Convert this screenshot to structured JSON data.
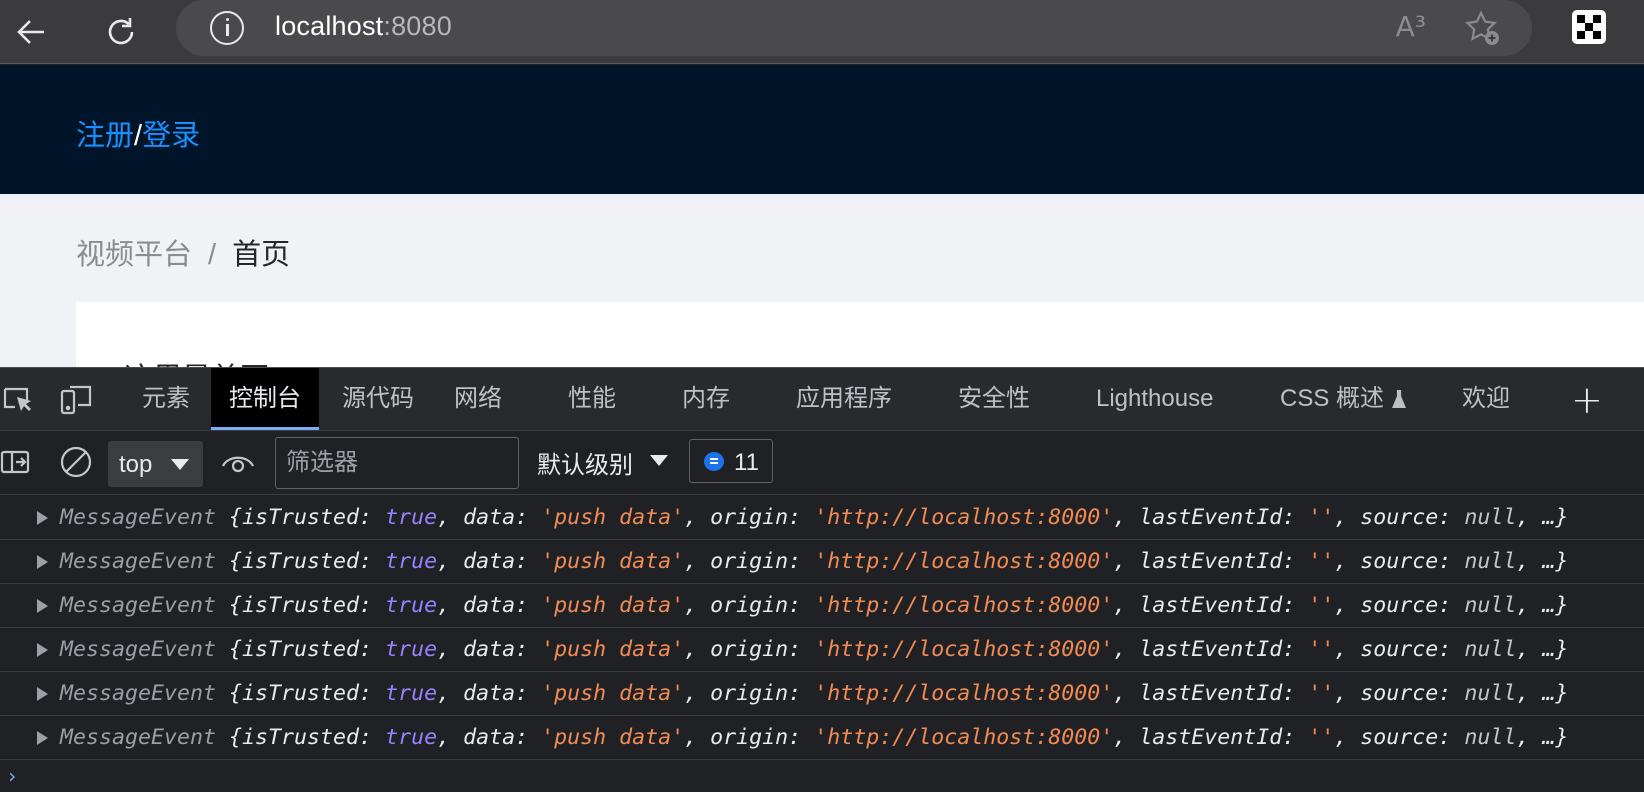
{
  "browser": {
    "url_host": "localhost",
    "url_port": ":8080",
    "read_aloud_icon": "A³",
    "colors": {
      "chrome": "#3b3b3d",
      "omnibox": "#4a4a4d"
    }
  },
  "page": {
    "auth": {
      "register": "注册",
      "separator": "/",
      "login": "登录"
    },
    "breadcrumb": {
      "root": "视频平台",
      "separator": "/",
      "current": "首页"
    },
    "welcome_text": "这里是首页",
    "colors": {
      "header": "#001529",
      "link": "#1890ff",
      "background": "#f0f2f5"
    }
  },
  "devtools": {
    "tabs": [
      "元素",
      "控制台",
      "源代码",
      "网络",
      "性能",
      "内存",
      "应用程序",
      "安全性",
      "Lighthouse",
      "CSS 概述",
      "欢迎"
    ],
    "active_tab": "控制台",
    "toolbar": {
      "context": "top",
      "filter_placeholder": "筛选器",
      "levels": "默认级别",
      "message_count": "11"
    },
    "console": {
      "log_entries": [
        {
          "type": "MessageEvent",
          "isTrusted": "true",
          "data": "'push data'",
          "origin": "'http://localhost:8000'",
          "lastEventId": "''",
          "source": "null"
        },
        {
          "type": "MessageEvent",
          "isTrusted": "true",
          "data": "'push data'",
          "origin": "'http://localhost:8000'",
          "lastEventId": "''",
          "source": "null"
        },
        {
          "type": "MessageEvent",
          "isTrusted": "true",
          "data": "'push data'",
          "origin": "'http://localhost:8000'",
          "lastEventId": "''",
          "source": "null"
        },
        {
          "type": "MessageEvent",
          "isTrusted": "true",
          "data": "'push data'",
          "origin": "'http://localhost:8000'",
          "lastEventId": "''",
          "source": "null"
        },
        {
          "type": "MessageEvent",
          "isTrusted": "true",
          "data": "'push data'",
          "origin": "'http://localhost:8000'",
          "lastEventId": "''",
          "source": "null"
        },
        {
          "type": "MessageEvent",
          "isTrusted": "true",
          "data": "'push data'",
          "origin": "'http://localhost:8000'",
          "lastEventId": "''",
          "source": "null"
        }
      ],
      "prompt_glyph": "›"
    },
    "colors": {
      "panel": "#202124",
      "tabbar": "#292a2d",
      "active_underline": "#7cacf8",
      "boolean": "#9980ff",
      "string": "#f28b54"
    }
  }
}
